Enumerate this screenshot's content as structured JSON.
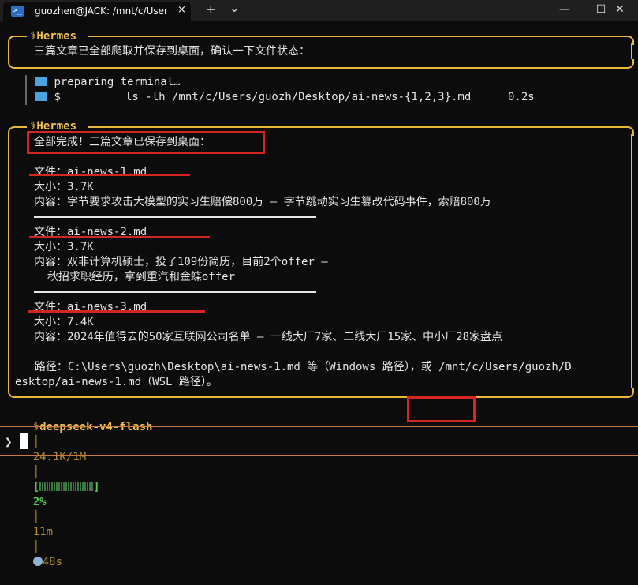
{
  "tab": {
    "title": "guozhen@JACK: /mnt/c/Users",
    "close_glyph": "×",
    "new_glyph": "+",
    "dropdown_glyph": "⌄"
  },
  "window": {
    "minimize": "—",
    "maximize": "☐",
    "close": "✕"
  },
  "block1": {
    "agent": "⚕Hermes",
    "message": "三篇文章已全部爬取并保存到桌面，确认一下文件状态："
  },
  "tool": {
    "preparing": "preparing terminal…",
    "cmd_prefix": "$",
    "command": "ls -lh /mnt/c/Users/guozh/Desktop/ai-news-{1,2,3}.md",
    "duration": "0.2s"
  },
  "block2": {
    "agent": "⚕Hermes",
    "heading": "全部完成！三篇文章已保存到桌面：",
    "files": [
      {
        "name_line": "文件：ai-news-1.md",
        "size_line": "大小：3.7K",
        "content_lines": [
          "内容：字节要求攻击大模型的实习生赔偿800万 — 字节跳动实习生篡改代码事件，索赔800万"
        ]
      },
      {
        "name_line": "文件：ai-news-2.md",
        "size_line": "大小：3.7K",
        "content_lines": [
          "内容：双非计算机硕士，投了109份简历，目前2个offer —",
          "  秋招求职经历，拿到重汽和金蝶offer"
        ]
      },
      {
        "name_line": "文件：ai-news-3.md",
        "size_line": "大小：7.4K",
        "content_lines": [
          "内容：2024年值得去的50家互联网公司名单 — 一线大厂7家、二线大厂15家、中小厂28家盘点"
        ]
      }
    ],
    "path_line1": "  路径：C:\\Users\\guozh\\Desktop\\ai-news-1.md 等（Windows 路径），或 /mnt/c/Users/guozh/D",
    "path_line2": "esktop/ai-news-1.md（WSL 路径）。"
  },
  "status": {
    "model": "⚕deepseek-v4-flash",
    "tokens": "24.1K/1M",
    "progress_percent": 2,
    "pct_label": "2%",
    "minutes": "11m",
    "elapsed": "48s",
    "sep": "│"
  },
  "prompt": {
    "symbol": "❯"
  },
  "colors": {
    "accent": "#f2c14e",
    "highlight": "#d42424",
    "progress": "#58c35b",
    "prompt_line": "#c9793b"
  }
}
